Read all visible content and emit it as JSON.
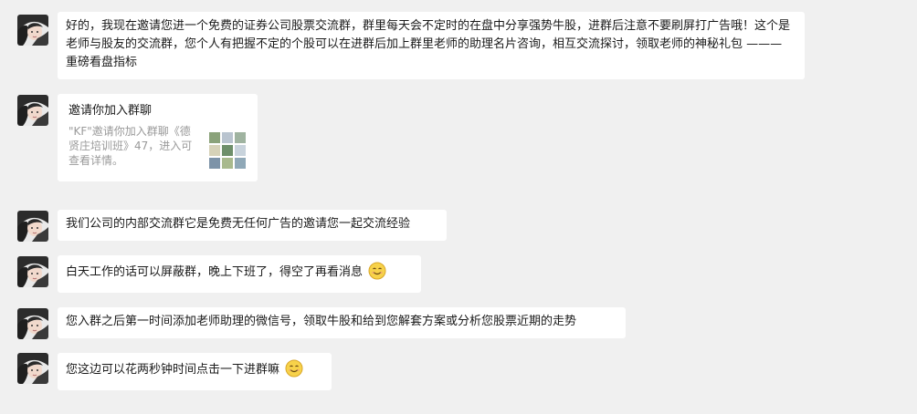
{
  "messages": [
    {
      "type": "text",
      "text": "好的，我现在邀请您进一个免费的证券公司股票交流群，群里每天会不定时的在盘中分享强势牛股，进群后注意不要刷屏打广告哦！这个是老师与股友的交流群，您个人有把握不定的个股可以在进群后加上群里老师的助理名片咨询，相互交流探讨，领取老师的神秘礼包 ——— 重磅看盘指标"
    },
    {
      "type": "card",
      "title": "邀请你加入群聊",
      "desc": "\"KF\"邀请你加入群聊《德贤庄培训班》47，进入可查看详情。"
    },
    {
      "type": "text",
      "text": "我们公司的内部交流群它是免费无任何广告的邀请您一起交流经验"
    },
    {
      "type": "text",
      "text": "白天工作的话可以屏蔽群，晚上下班了，得空了再看消息"
    },
    {
      "type": "text",
      "text": "您入群之后第一时间添加老师助理的微信号，领取牛股和给到您解套方案或分析您股票近期的走势"
    },
    {
      "type": "text",
      "text": "您这边可以花两秒钟时间点击一下进群嘛"
    }
  ],
  "icons": {
    "avatar": "avatar-photo",
    "emoji": "smile-emoji-icon",
    "card_thumbnail": "group-avatar-grid"
  },
  "colors": {
    "background": "#f0f0f0",
    "bubble": "#ffffff",
    "secondary_text": "#9a9a9a"
  }
}
